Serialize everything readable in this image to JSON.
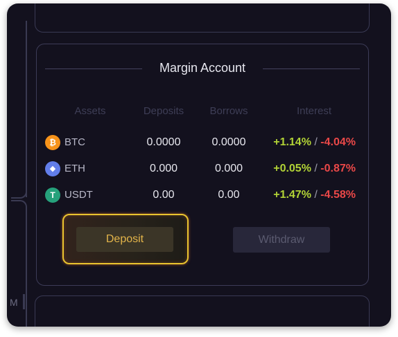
{
  "rail": {
    "partial_text": "M"
  },
  "margin_account": {
    "title": "Margin Account",
    "columns": [
      "Assets",
      "Deposits",
      "Borrows",
      "Interest"
    ],
    "rows": [
      {
        "asset": "BTC",
        "icon": "bitcoin-icon",
        "icon_color": "#f7931a",
        "icon_glyph": "₿",
        "deposits": "0.0000",
        "borrows": "0.0000",
        "interest_positive": "+1.14%",
        "separator": "/",
        "interest_negative": "-4.04%"
      },
      {
        "asset": "ETH",
        "icon": "ethereum-icon",
        "icon_color": "#627eea",
        "icon_glyph": "◆",
        "deposits": "0.000",
        "borrows": "0.000",
        "interest_positive": "+0.05%",
        "separator": "/",
        "interest_negative": "-0.87%"
      },
      {
        "asset": "USDT",
        "icon": "tether-icon",
        "icon_color": "#26a17b",
        "icon_glyph": "T",
        "deposits": "0.00",
        "borrows": "0.00",
        "interest_positive": "+1.47%",
        "separator": "/",
        "interest_negative": "-4.58%"
      }
    ],
    "deposit_label": "Deposit",
    "withdraw_label": "Withdraw"
  },
  "colors": {
    "positive": "#b2d336",
    "negative": "#ea4848",
    "highlight": "#e9c42f",
    "background": "#13111e"
  }
}
